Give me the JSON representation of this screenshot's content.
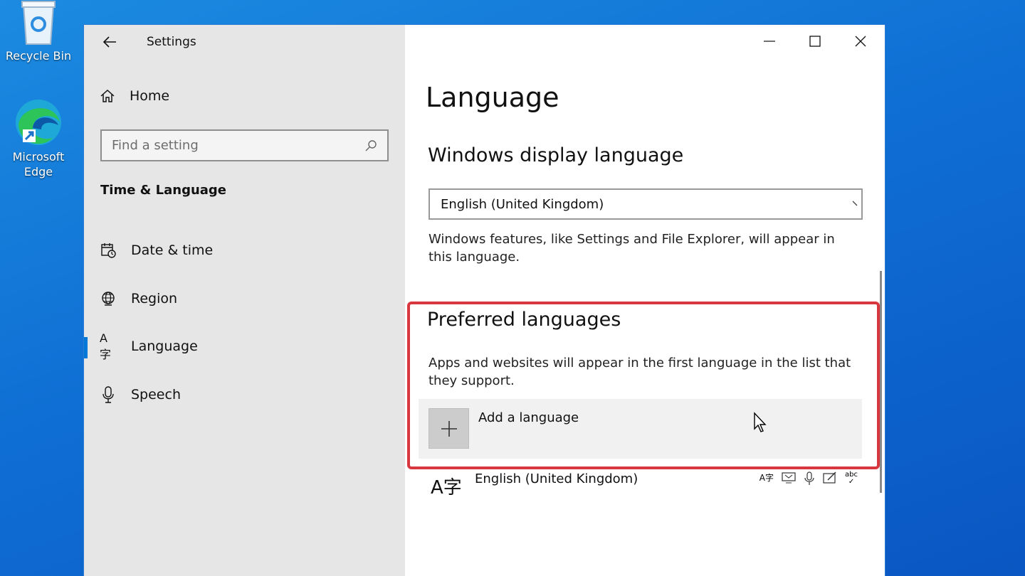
{
  "desktop": {
    "icons": [
      {
        "label": "Recycle Bin",
        "icon": "recycle-bin-icon"
      },
      {
        "label": "Microsoft Edge",
        "icon": "edge-icon"
      }
    ]
  },
  "window": {
    "title": "Settings",
    "controls": {
      "minimize": "minimize-icon",
      "maximize": "maximize-icon",
      "close": "close-icon"
    }
  },
  "sidebar": {
    "home_label": "Home",
    "search": {
      "placeholder": "Find a setting"
    },
    "section_title": "Time & Language",
    "items": [
      {
        "label": "Date & time",
        "icon": "calendar-clock-icon",
        "active": false
      },
      {
        "label": "Region",
        "icon": "globe-icon",
        "active": false
      },
      {
        "label": "Language",
        "icon": "language-icon",
        "active": true
      },
      {
        "label": "Speech",
        "icon": "microphone-icon",
        "active": false
      }
    ]
  },
  "main": {
    "page_title": "Language",
    "display_language": {
      "heading": "Windows display language",
      "selected": "English (United Kingdom)",
      "description": "Windows features, like Settings and File Explorer, will appear in this language."
    },
    "preferred": {
      "heading": "Preferred languages",
      "description": "Apps and websites will appear in the first language in the list that they support.",
      "add_label": "Add a language",
      "languages": [
        {
          "glyph": "A字",
          "name": "English (United Kingdom)"
        }
      ]
    }
  },
  "colors": {
    "accent": "#0078d7",
    "highlight": "#d9373f",
    "sidebar_bg": "#e6e6e6"
  }
}
